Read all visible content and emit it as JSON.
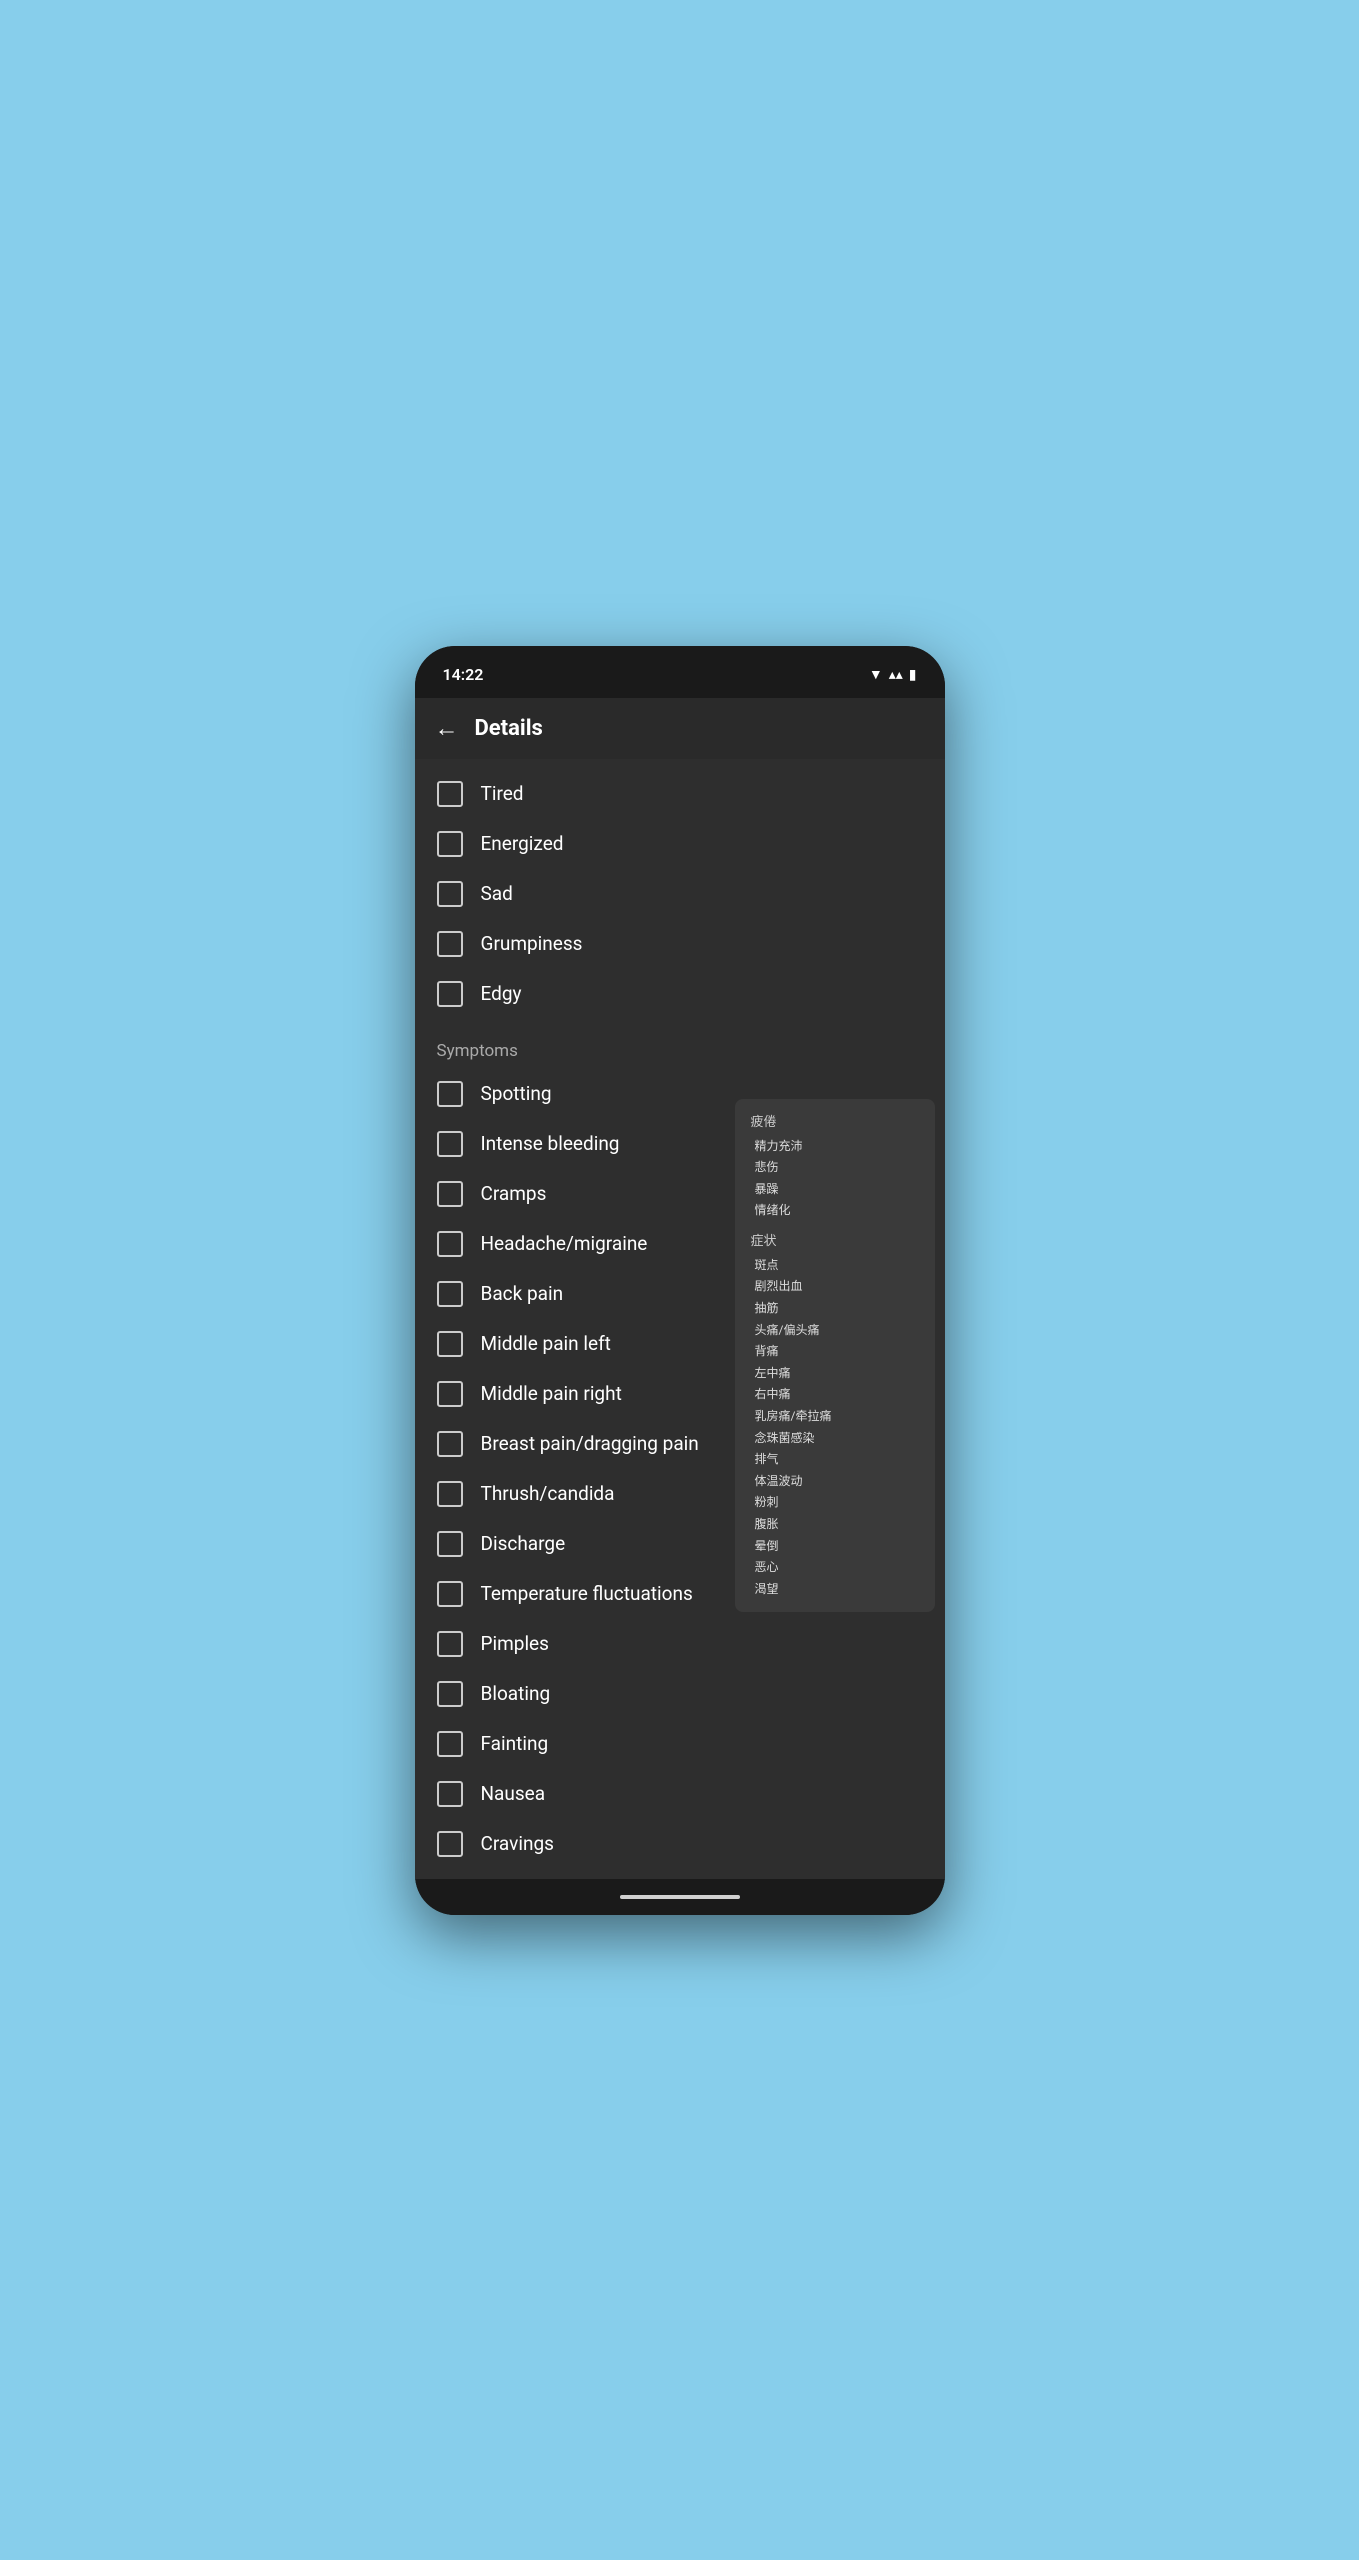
{
  "statusBar": {
    "time": "14:22",
    "wifiIcon": "▼",
    "signalIcon": "▲",
    "batteryIcon": "▮"
  },
  "header": {
    "backLabel": "←",
    "title": "Details"
  },
  "moods": [
    {
      "label": "Tired"
    },
    {
      "label": "Energized"
    },
    {
      "label": "Sad"
    },
    {
      "label": "Grumpiness"
    },
    {
      "label": "Edgy"
    }
  ],
  "symptomsLabel": "Symptoms",
  "symptoms": [
    {
      "label": "Spotting"
    },
    {
      "label": "Intense bleeding"
    },
    {
      "label": "Cramps"
    },
    {
      "label": "Headache/migraine"
    },
    {
      "label": "Back pain"
    },
    {
      "label": "Middle pain left"
    },
    {
      "label": "Middle pain right"
    },
    {
      "label": "Breast pain/dragging pain"
    },
    {
      "label": "Thrush/candida"
    },
    {
      "label": "Discharge"
    },
    {
      "label": "Temperature fluctuations"
    },
    {
      "label": "Pimples"
    },
    {
      "label": "Bloating"
    },
    {
      "label": "Fainting"
    },
    {
      "label": "Nausea"
    },
    {
      "label": "Cravings"
    }
  ],
  "tooltip": {
    "section1Label": "疲倦",
    "section1Items": [
      "□精力充沛",
      "□悲伤",
      "□暴躁",
      "□情绪化"
    ],
    "section2Label": "症状",
    "section2Items": [
      "□斑点",
      "□剧烈出血",
      "□抽筋",
      "□头痛/偏头痛",
      "□背痛",
      "□左中痛",
      "□右中痛",
      "□乳房痛/牵拉痛",
      "□念珠菌感染",
      "□排气",
      "□体温波动",
      "□粉刺",
      "□腹胀",
      "□晕倒",
      "□恶心",
      "□渴望"
    ]
  }
}
